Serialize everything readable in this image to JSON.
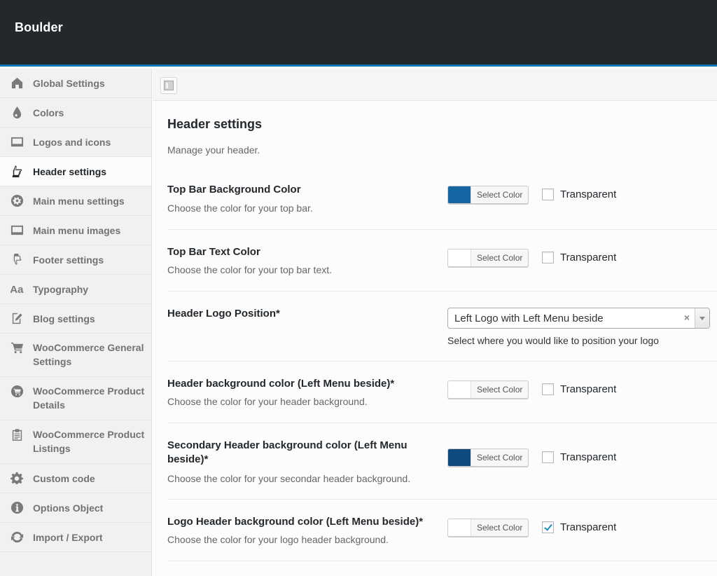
{
  "app": {
    "title": "Boulder"
  },
  "sidebar": {
    "items": [
      {
        "label": "Global Settings",
        "icon": "home-icon",
        "active": false
      },
      {
        "label": "Colors",
        "icon": "drop-icon",
        "active": false
      },
      {
        "label": "Logos and icons",
        "icon": "monitor-icon",
        "active": false
      },
      {
        "label": "Header settings",
        "icon": "hand-up-icon",
        "active": true
      },
      {
        "label": "Main menu settings",
        "icon": "cog-circle-icon",
        "active": false
      },
      {
        "label": "Main menu images",
        "icon": "monitor-icon",
        "active": false
      },
      {
        "label": "Footer settings",
        "icon": "hand-down-icon",
        "active": false
      },
      {
        "label": "Typography",
        "icon": "font-icon",
        "active": false
      },
      {
        "label": "Blog settings",
        "icon": "edit-icon",
        "active": false
      },
      {
        "label": "WooCommerce General Settings",
        "icon": "cart-icon",
        "active": false
      },
      {
        "label": "WooCommerce Product Details",
        "icon": "cart-circle-icon",
        "active": false
      },
      {
        "label": "WooCommerce Product Listings",
        "icon": "clipboard-icon",
        "active": false
      },
      {
        "label": "Custom code",
        "icon": "gear-icon",
        "active": false
      },
      {
        "label": "Options Object",
        "icon": "info-icon",
        "active": false
      },
      {
        "label": "Import / Export",
        "icon": "refresh-icon",
        "active": false
      }
    ]
  },
  "toolbar": {
    "expand_icon": "expand-panel-icon"
  },
  "main": {
    "title": "Header settings",
    "description": "Manage your header.",
    "select_color_label": "Select Color",
    "transparent_label": "Transparent",
    "fields": [
      {
        "title": "Top Bar Background Color",
        "subtitle": "Choose the color for your top bar.",
        "type": "color",
        "color": "#1565a3",
        "transparent": false
      },
      {
        "title": "Top Bar Text Color",
        "subtitle": "Choose the color for your top bar text.",
        "type": "color",
        "color": "#ffffff",
        "transparent": false
      },
      {
        "title": "Header Logo Position*",
        "type": "select",
        "value": "Left Logo with Left Menu beside",
        "hint": "Select where you would like to position your logo"
      },
      {
        "title": "Header background color (Left Menu beside)*",
        "subtitle": "Choose the color for your header background.",
        "type": "color",
        "color": "#ffffff",
        "transparent": false
      },
      {
        "title": "Secondary Header background color (Left Menu beside)*",
        "subtitle": "Choose the color for your secondar header background.",
        "type": "color",
        "color": "#0f4a7e",
        "transparent": false
      },
      {
        "title": "Logo Header background color (Left Menu beside)*",
        "subtitle": "Choose the color for your logo header background.",
        "type": "color",
        "color": "#ffffff",
        "transparent": true
      }
    ]
  }
}
